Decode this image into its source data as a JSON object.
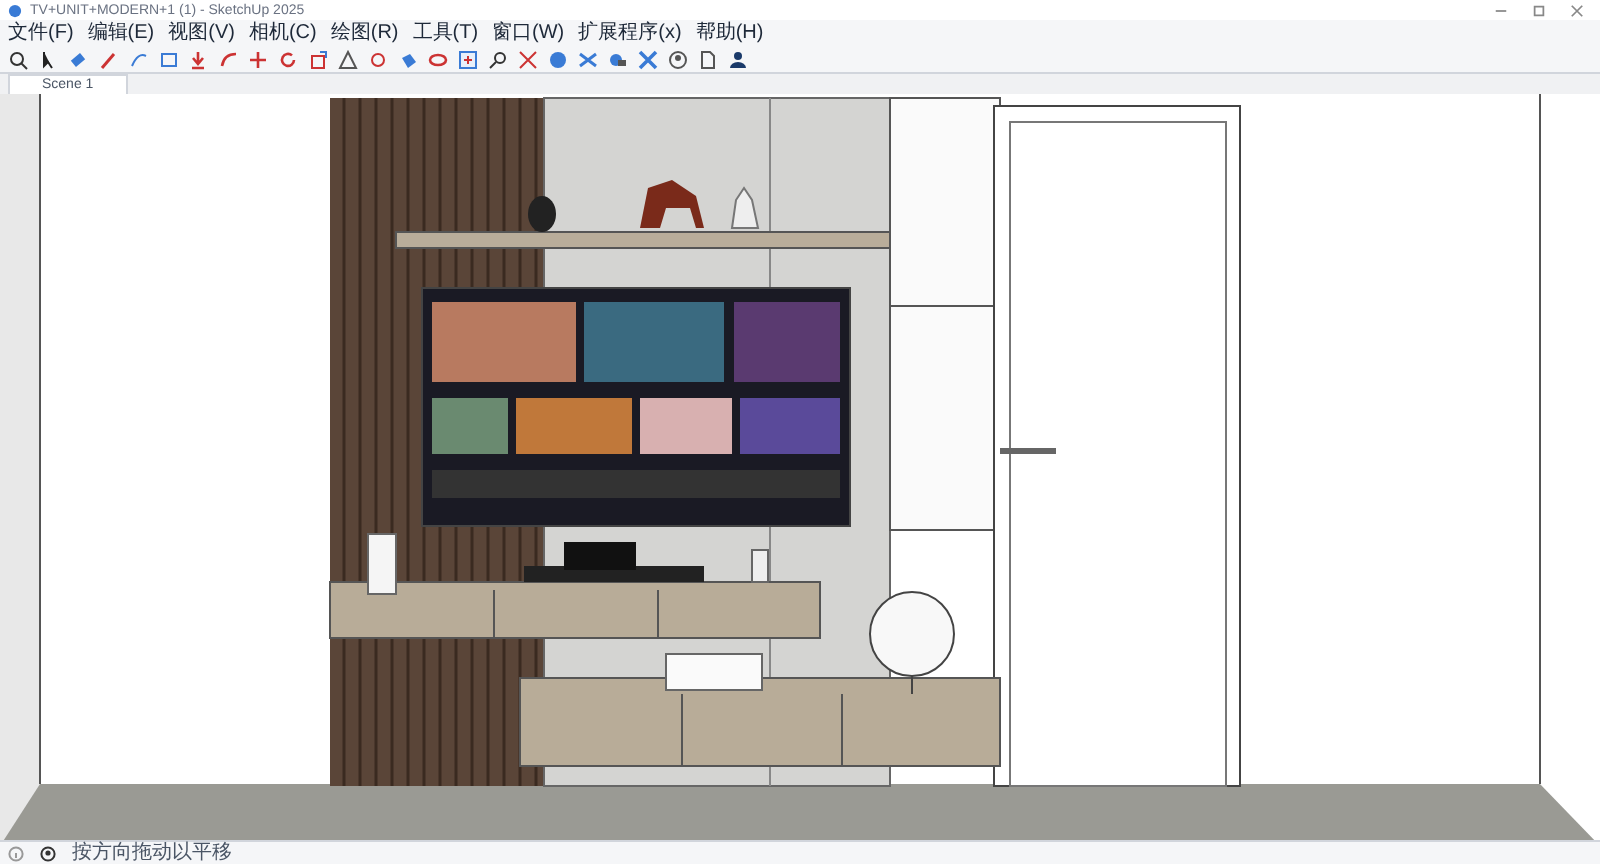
{
  "window": {
    "title": "TV+UNIT+MODERN+1 (1) - SketchUp 2025"
  },
  "menu": [
    "文件(F)",
    "编辑(E)",
    "视图(V)",
    "相机(C)",
    "绘图(R)",
    "工具(T)",
    "窗口(W)",
    "扩展程序(x)",
    "帮助(H)"
  ],
  "tabs": [
    {
      "label": "Scene 1",
      "selected": true
    }
  ],
  "status_bar": {
    "hint": "按方向拖动以平移"
  }
}
